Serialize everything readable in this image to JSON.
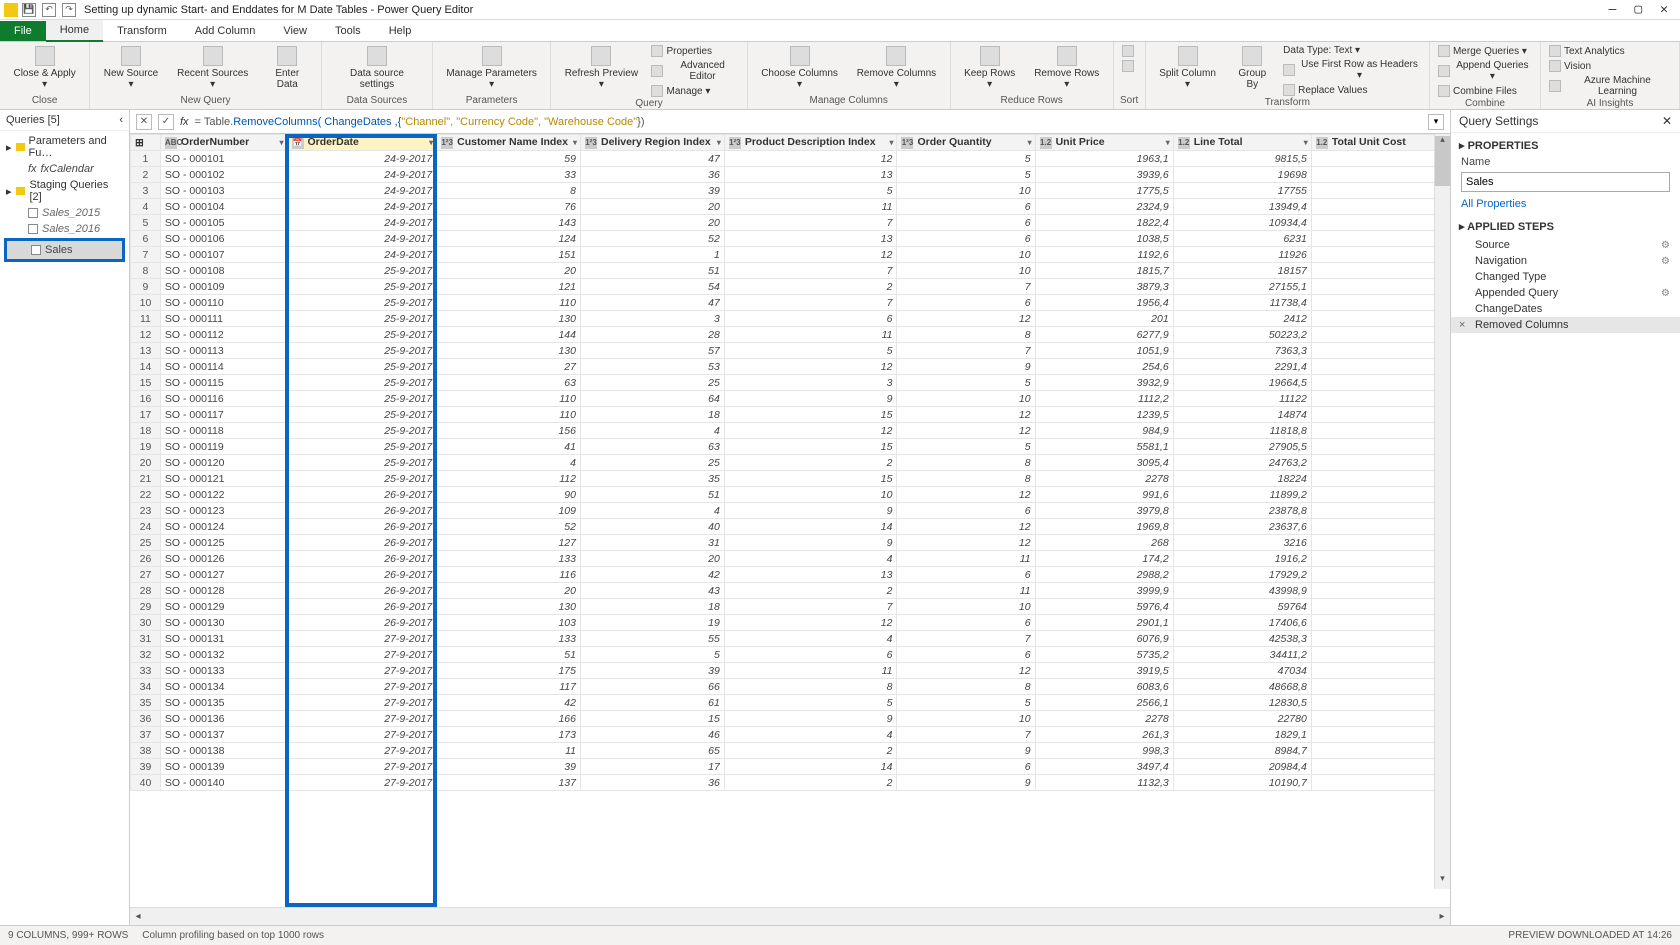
{
  "window": {
    "title": "Setting up dynamic Start- and Enddates for M Date Tables - Power Query Editor"
  },
  "menutabs": [
    "File",
    "Home",
    "Transform",
    "Add Column",
    "View",
    "Tools",
    "Help"
  ],
  "ribbon": {
    "close": {
      "closeApply": "Close &\nApply ▾",
      "group": "Close"
    },
    "newquery": {
      "newSource": "New\nSource ▾",
      "recent": "Recent\nSources ▾",
      "enter": "Enter\nData",
      "group": "New Query"
    },
    "datasources": {
      "settings": "Data source\nsettings",
      "group": "Data Sources"
    },
    "parameters": {
      "manage": "Manage\nParameters ▾",
      "group": "Parameters"
    },
    "query": {
      "refresh": "Refresh\nPreview ▾",
      "props": "Properties",
      "adv": "Advanced Editor",
      "mng": "Manage ▾",
      "group": "Query"
    },
    "managecols": {
      "choose": "Choose\nColumns ▾",
      "remove": "Remove\nColumns ▾",
      "group": "Manage Columns"
    },
    "reducerows": {
      "keep": "Keep\nRows ▾",
      "rem": "Remove\nRows ▾",
      "group": "Reduce Rows"
    },
    "sort": {
      "group": "Sort"
    },
    "transform2": {
      "split": "Split\nColumn ▾",
      "groupby": "Group\nBy",
      "datatype": "Data Type: Text ▾",
      "firstrow": "Use First Row as Headers ▾",
      "replace": "Replace Values",
      "group": "Transform"
    },
    "combine": {
      "merge": "Merge Queries ▾",
      "append": "Append Queries ▾",
      "combinefiles": "Combine Files",
      "group": "Combine"
    },
    "ai": {
      "text": "Text Analytics",
      "vision": "Vision",
      "azure": "Azure Machine Learning",
      "group": "AI Insights"
    }
  },
  "queriesPanel": {
    "title": "Queries [5]",
    "groups": [
      {
        "label": "Parameters and Fu…",
        "type": "folder"
      },
      {
        "label": "fxCalendar",
        "type": "fx"
      },
      {
        "label": "Staging Queries [2]",
        "type": "folder"
      },
      {
        "label": "Sales_2015",
        "type": "italic"
      },
      {
        "label": "Sales_2016",
        "type": "italic"
      },
      {
        "label": "Sales",
        "type": "selected"
      }
    ]
  },
  "formula": {
    "prefix": "= Table.",
    "fn": "RemoveColumns( ChangeDates ,{",
    "args": "\"Channel\", \"Currency Code\", \"Warehouse Code\"",
    "suffix": "})"
  },
  "columns": [
    {
      "type": "ABC",
      "label": "OrderNumber"
    },
    {
      "type": "📅",
      "label": "OrderDate"
    },
    {
      "type": "1²3",
      "label": "Customer Name Index"
    },
    {
      "type": "1²3",
      "label": "Delivery Region Index"
    },
    {
      "type": "1²3",
      "label": "Product Description Index"
    },
    {
      "type": "1²3",
      "label": "Order Quantity"
    },
    {
      "type": "1.2",
      "label": "Unit Price"
    },
    {
      "type": "1.2",
      "label": "Line Total"
    },
    {
      "type": "1.2",
      "label": "Total Unit Cost"
    }
  ],
  "rows": [
    [
      "SO - 000101",
      "24-9-2017",
      "59",
      "47",
      "12",
      "5",
      "1963,1",
      "9815,5",
      ""
    ],
    [
      "SO - 000102",
      "24-9-2017",
      "33",
      "36",
      "13",
      "5",
      "3939,6",
      "19698",
      ""
    ],
    [
      "SO - 000103",
      "24-9-2017",
      "8",
      "39",
      "5",
      "10",
      "1775,5",
      "17755",
      ""
    ],
    [
      "SO - 000104",
      "24-9-2017",
      "76",
      "20",
      "11",
      "6",
      "2324,9",
      "13949,4",
      ""
    ],
    [
      "SO - 000105",
      "24-9-2017",
      "143",
      "20",
      "7",
      "6",
      "1822,4",
      "10934,4",
      ""
    ],
    [
      "SO - 000106",
      "24-9-2017",
      "124",
      "52",
      "13",
      "6",
      "1038,5",
      "6231",
      ""
    ],
    [
      "SO - 000107",
      "24-9-2017",
      "151",
      "1",
      "12",
      "10",
      "1192,6",
      "11926",
      ""
    ],
    [
      "SO - 000108",
      "25-9-2017",
      "20",
      "51",
      "7",
      "10",
      "1815,7",
      "18157",
      ""
    ],
    [
      "SO - 000109",
      "25-9-2017",
      "121",
      "54",
      "2",
      "7",
      "3879,3",
      "27155,1",
      ""
    ],
    [
      "SO - 000110",
      "25-9-2017",
      "110",
      "47",
      "7",
      "6",
      "1956,4",
      "11738,4",
      ""
    ],
    [
      "SO - 000111",
      "25-9-2017",
      "130",
      "3",
      "6",
      "12",
      "201",
      "2412",
      ""
    ],
    [
      "SO - 000112",
      "25-9-2017",
      "144",
      "28",
      "11",
      "8",
      "6277,9",
      "50223,2",
      ""
    ],
    [
      "SO - 000113",
      "25-9-2017",
      "130",
      "57",
      "5",
      "7",
      "1051,9",
      "7363,3",
      ""
    ],
    [
      "SO - 000114",
      "25-9-2017",
      "27",
      "53",
      "12",
      "9",
      "254,6",
      "2291,4",
      ""
    ],
    [
      "SO - 000115",
      "25-9-2017",
      "63",
      "25",
      "3",
      "5",
      "3932,9",
      "19664,5",
      ""
    ],
    [
      "SO - 000116",
      "25-9-2017",
      "110",
      "64",
      "9",
      "10",
      "1112,2",
      "11122",
      ""
    ],
    [
      "SO - 000117",
      "25-9-2017",
      "110",
      "18",
      "15",
      "12",
      "1239,5",
      "14874",
      ""
    ],
    [
      "SO - 000118",
      "25-9-2017",
      "156",
      "4",
      "12",
      "12",
      "984,9",
      "11818,8",
      ""
    ],
    [
      "SO - 000119",
      "25-9-2017",
      "41",
      "63",
      "15",
      "5",
      "5581,1",
      "27905,5",
      ""
    ],
    [
      "SO - 000120",
      "25-9-2017",
      "4",
      "25",
      "2",
      "8",
      "3095,4",
      "24763,2",
      ""
    ],
    [
      "SO - 000121",
      "25-9-2017",
      "112",
      "35",
      "15",
      "8",
      "2278",
      "18224",
      ""
    ],
    [
      "SO - 000122",
      "26-9-2017",
      "90",
      "51",
      "10",
      "12",
      "991,6",
      "11899,2",
      ""
    ],
    [
      "SO - 000123",
      "26-9-2017",
      "109",
      "4",
      "9",
      "6",
      "3979,8",
      "23878,8",
      ""
    ],
    [
      "SO - 000124",
      "26-9-2017",
      "52",
      "40",
      "14",
      "12",
      "1969,8",
      "23637,6",
      ""
    ],
    [
      "SO - 000125",
      "26-9-2017",
      "127",
      "31",
      "9",
      "12",
      "268",
      "3216",
      ""
    ],
    [
      "SO - 000126",
      "26-9-2017",
      "133",
      "20",
      "4",
      "11",
      "174,2",
      "1916,2",
      ""
    ],
    [
      "SO - 000127",
      "26-9-2017",
      "116",
      "42",
      "13",
      "6",
      "2988,2",
      "17929,2",
      ""
    ],
    [
      "SO - 000128",
      "26-9-2017",
      "20",
      "43",
      "2",
      "11",
      "3999,9",
      "43998,9",
      ""
    ],
    [
      "SO - 000129",
      "26-9-2017",
      "130",
      "18",
      "7",
      "10",
      "5976,4",
      "59764",
      ""
    ],
    [
      "SO - 000130",
      "26-9-2017",
      "103",
      "19",
      "12",
      "6",
      "2901,1",
      "17406,6",
      ""
    ],
    [
      "SO - 000131",
      "27-9-2017",
      "133",
      "55",
      "4",
      "7",
      "6076,9",
      "42538,3",
      ""
    ],
    [
      "SO - 000132",
      "27-9-2017",
      "51",
      "5",
      "6",
      "6",
      "5735,2",
      "34411,2",
      ""
    ],
    [
      "SO - 000133",
      "27-9-2017",
      "175",
      "39",
      "11",
      "12",
      "3919,5",
      "47034",
      ""
    ],
    [
      "SO - 000134",
      "27-9-2017",
      "117",
      "66",
      "8",
      "8",
      "6083,6",
      "48668,8",
      ""
    ],
    [
      "SO - 000135",
      "27-9-2017",
      "42",
      "61",
      "5",
      "5",
      "2566,1",
      "12830,5",
      ""
    ],
    [
      "SO - 000136",
      "27-9-2017",
      "166",
      "15",
      "9",
      "10",
      "2278",
      "22780",
      ""
    ],
    [
      "SO - 000137",
      "27-9-2017",
      "173",
      "46",
      "4",
      "7",
      "261,3",
      "1829,1",
      ""
    ],
    [
      "SO - 000138",
      "27-9-2017",
      "11",
      "65",
      "2",
      "9",
      "998,3",
      "8984,7",
      ""
    ],
    [
      "SO - 000139",
      "27-9-2017",
      "39",
      "17",
      "14",
      "6",
      "3497,4",
      "20984,4",
      ""
    ],
    [
      "SO - 000140",
      "27-9-2017",
      "137",
      "36",
      "2",
      "9",
      "1132,3",
      "10190,7",
      ""
    ]
  ],
  "qsettings": {
    "title": "Query Settings",
    "properties": "PROPERTIES",
    "nameLabel": "Name",
    "nameValue": "Sales",
    "allProps": "All Properties",
    "applied": "APPLIED STEPS",
    "steps": [
      {
        "label": "Source",
        "gear": true
      },
      {
        "label": "Navigation",
        "gear": true
      },
      {
        "label": "Changed Type",
        "gear": false
      },
      {
        "label": "Appended Query",
        "gear": true
      },
      {
        "label": "ChangeDates",
        "gear": false
      },
      {
        "label": "Removed Columns",
        "gear": false,
        "selected": true
      }
    ]
  },
  "statusbar": {
    "left": "9 COLUMNS, 999+ ROWS",
    "mid": "Column profiling based on top 1000 rows",
    "right": "PREVIEW DOWNLOADED AT 14:26"
  }
}
